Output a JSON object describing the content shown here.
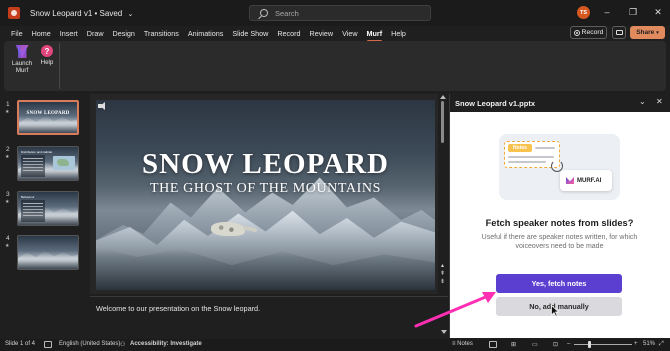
{
  "window": {
    "doc_title": "Snow Leopard v1",
    "save_state": "Saved",
    "search_placeholder": "Search",
    "avatar_initials": "TS"
  },
  "ribbon": {
    "tabs": [
      "File",
      "Home",
      "Insert",
      "Draw",
      "Design",
      "Transitions",
      "Animations",
      "Slide Show",
      "Record",
      "Review",
      "View",
      "Murf",
      "Help"
    ],
    "active_tab": "Murf",
    "record_label": "Record",
    "share_label": "Share",
    "murf_group": {
      "launch_label_1": "Launch",
      "launch_label_2": "Murf",
      "help_label": "Help"
    }
  },
  "thumbnails": [
    {
      "number": "1",
      "title": "SNOW LEOPARD"
    },
    {
      "number": "2",
      "title": "Distribution and Habitat"
    },
    {
      "number": "3",
      "title": "Behaviour"
    },
    {
      "number": "4",
      "title": ""
    }
  ],
  "slide": {
    "title": "SNOW LEOPARD",
    "subtitle": "THE GHOST OF THE MOUNTAINS"
  },
  "notes": {
    "text": "Welcome to our presentation on the Snow leopard."
  },
  "addin": {
    "pane_title": "Snow Leopard v1.pptx",
    "notes_tag": "Notes",
    "murf_badge": "MURF.AI",
    "heading": "Fetch speaker notes from slides?",
    "description": "Useful if there are speaker notes written, for which voiceovers need to be made",
    "primary_button": "Yes, fetch notes",
    "secondary_button": "No, add manually"
  },
  "status": {
    "slide_info": "Slide 1 of 4",
    "language": "English (United States)",
    "accessibility": "Accessibility: Investigate",
    "notes_label": "Notes",
    "zoom": "51%"
  },
  "colors": {
    "accent_tab": "#d2694a",
    "share": "#e08a5e",
    "primary_button": "#5b3fd0",
    "annotation_arrow": "#ff2fb3"
  }
}
